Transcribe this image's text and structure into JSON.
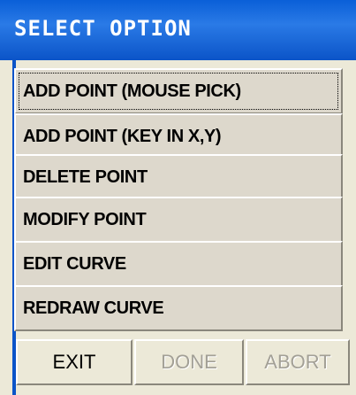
{
  "window": {
    "title": "SELECT OPTION"
  },
  "options": [
    {
      "label": "ADD POINT (MOUSE PICK)"
    },
    {
      "label": "ADD POINT (KEY IN X,Y)"
    },
    {
      "label": "DELETE POINT"
    },
    {
      "label": "MODIFY POINT"
    },
    {
      "label": "EDIT CURVE"
    },
    {
      "label": "REDRAW CURVE"
    }
  ],
  "buttons": {
    "exit": {
      "label": "EXIT",
      "enabled": true
    },
    "done": {
      "label": "DONE",
      "enabled": false
    },
    "abort": {
      "label": "ABORT",
      "enabled": false
    }
  },
  "colors": {
    "titlebar": "#0b54c8",
    "face": "#ece9d8",
    "disabled_text": "#a3a096"
  }
}
